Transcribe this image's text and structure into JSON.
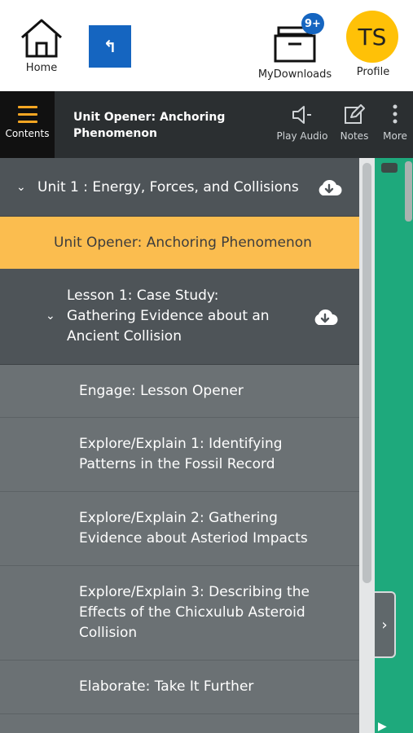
{
  "header": {
    "home_label": "Home",
    "back_icon": "back-arrow-icon",
    "downloads_label": "MyDownloads",
    "downloads_badge": "9+",
    "profile_initials": "TS",
    "profile_label": "Profile",
    "profile_color": "#ffc107",
    "accent_color": "#1565c0"
  },
  "toolbar": {
    "contents_label": "Contents",
    "title": "Unit Opener: Anchoring Phenomenon",
    "play_audio_label": "Play Audio",
    "notes_label": "Notes",
    "more_label": "More"
  },
  "contents": {
    "unit": {
      "label": "Unit 1 : Energy, Forces, and Collisions",
      "expanded": true
    },
    "active_item": "Unit Opener: Anchoring Phenomenon",
    "active_color": "#fbbd4f",
    "lesson": {
      "label": "Lesson 1: Case Study: Gathering Evidence about an Ancient Collision",
      "expanded": true
    },
    "sub_items": [
      {
        "label": "Engage: Lesson Opener"
      },
      {
        "label": "Explore/Explain 1: Identifying Patterns in the Fossil Record"
      },
      {
        "label": "Explore/Explain 2: Gathering Evidence about Asteriod Impacts"
      },
      {
        "label": "Explore/Explain 3: Describing the Effects of the Chicxulub Asteroid Collision"
      },
      {
        "label": "Elaborate: Take It Further"
      }
    ]
  }
}
